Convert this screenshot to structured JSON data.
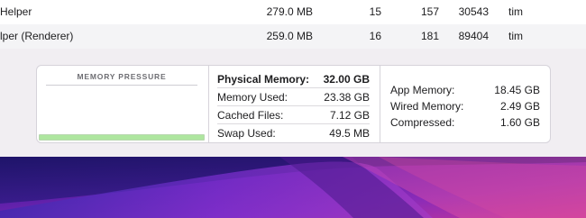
{
  "processes": [
    {
      "name": "Helper",
      "memory": "279.0 MB",
      "threads": "15",
      "ports": "157",
      "pid": "30543",
      "user": "tim"
    },
    {
      "name": "lper (Renderer)",
      "memory": "259.0 MB",
      "threads": "16",
      "ports": "181",
      "pid": "89404",
      "user": "tim"
    }
  ],
  "memory_pressure": {
    "title": "MEMORY PRESSURE",
    "level": 1.0,
    "color": "#aee69f"
  },
  "stats_middle": [
    {
      "label": "Physical Memory:",
      "value": "32.00 GB"
    },
    {
      "label": "Memory Used:",
      "value": "23.38 GB"
    },
    {
      "label": "Cached Files:",
      "value": "7.12 GB"
    },
    {
      "label": "Swap Used:",
      "value": "49.5 MB"
    }
  ],
  "stats_right": [
    {
      "label": "App Memory:",
      "value": "18.45 GB"
    },
    {
      "label": "Wired Memory:",
      "value": "2.49 GB"
    },
    {
      "label": "Compressed:",
      "value": "1.60 GB"
    }
  ]
}
